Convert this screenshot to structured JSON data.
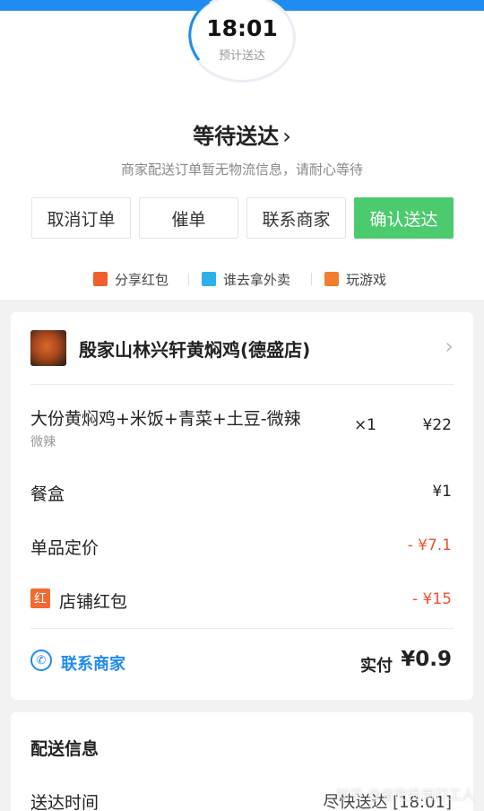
{
  "timer": {
    "time": "18:01",
    "label": "预计送达"
  },
  "status": {
    "title": "等待送达",
    "chevron": "›",
    "subtitle": "商家配送订单暂无物流信息，请耐心等待"
  },
  "actions": [
    {
      "label": "取消订单"
    },
    {
      "label": "催单"
    },
    {
      "label": "联系商家"
    },
    {
      "label": "确认送达"
    }
  ],
  "promos": [
    {
      "label": "分享红包",
      "icon": "red-envelope-icon",
      "color": "#f0602c"
    },
    {
      "label": "谁去拿外卖",
      "icon": "dice-icon",
      "color": "#2db1e8"
    },
    {
      "label": "玩游戏",
      "icon": "gamepad-icon",
      "color": "#f07e2c"
    }
  ],
  "shop": {
    "name": "殷家山林兴轩黄焖鸡(德盛店)",
    "chevron": "›"
  },
  "item": {
    "name": "大份黄焖鸡+米饭+青菜+土豆-微辣",
    "spec": "微辣",
    "qty": "×1",
    "price": "¥22"
  },
  "box": {
    "label": "餐盒",
    "value": "¥1"
  },
  "discount": {
    "label": "单品定价",
    "value": "- ¥7.1"
  },
  "redpacket": {
    "icon_text": "红",
    "label": "店铺红包",
    "value": "- ¥15"
  },
  "footer": {
    "contact": "联系商家",
    "paid_label": "实付",
    "paid_value": "¥0.9"
  },
  "delivery": {
    "heading": "配送信息",
    "time_label": "送达时间",
    "time_value": "尽快送达 [18:01]"
  },
  "watermark": "知乎 @省吃俭用打工人",
  "colors": {
    "accent": "#1e8cf0",
    "confirm": "#4cca6e",
    "discount": "#e8542e"
  }
}
